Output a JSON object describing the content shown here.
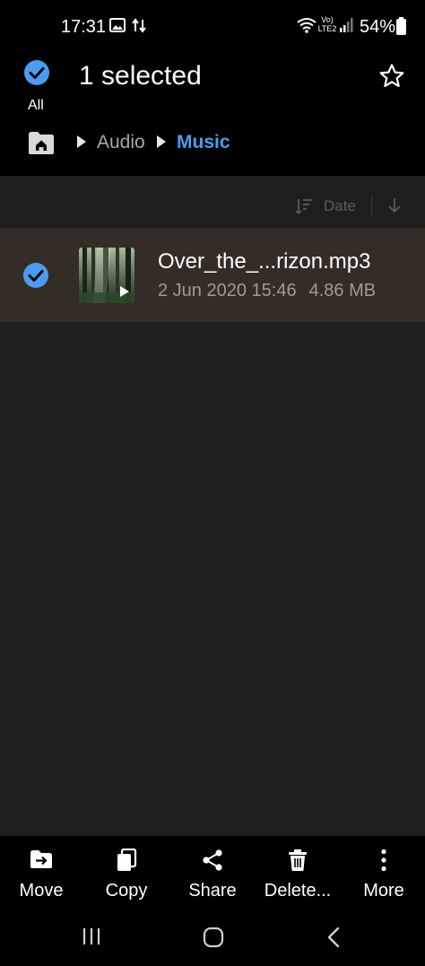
{
  "status": {
    "time": "17:31",
    "network_label": "Vo) LTE2",
    "battery": "54%"
  },
  "header": {
    "select_all_label": "All",
    "selected_text": "1 selected"
  },
  "breadcrumb": {
    "items": [
      "Audio",
      "Music"
    ]
  },
  "sort": {
    "label": "Date"
  },
  "files": [
    {
      "name": "Over_the_...rizon.mp3",
      "date": "2 Jun 2020 15:46",
      "size": "4.86 MB",
      "selected": true
    }
  ],
  "actions": {
    "move": "Move",
    "copy": "Copy",
    "share": "Share",
    "delete": "Delete...",
    "more": "More"
  },
  "colors": {
    "accent": "#4b9cf3",
    "selected_row": "#332d25",
    "list_bg": "#1e1e1e"
  }
}
